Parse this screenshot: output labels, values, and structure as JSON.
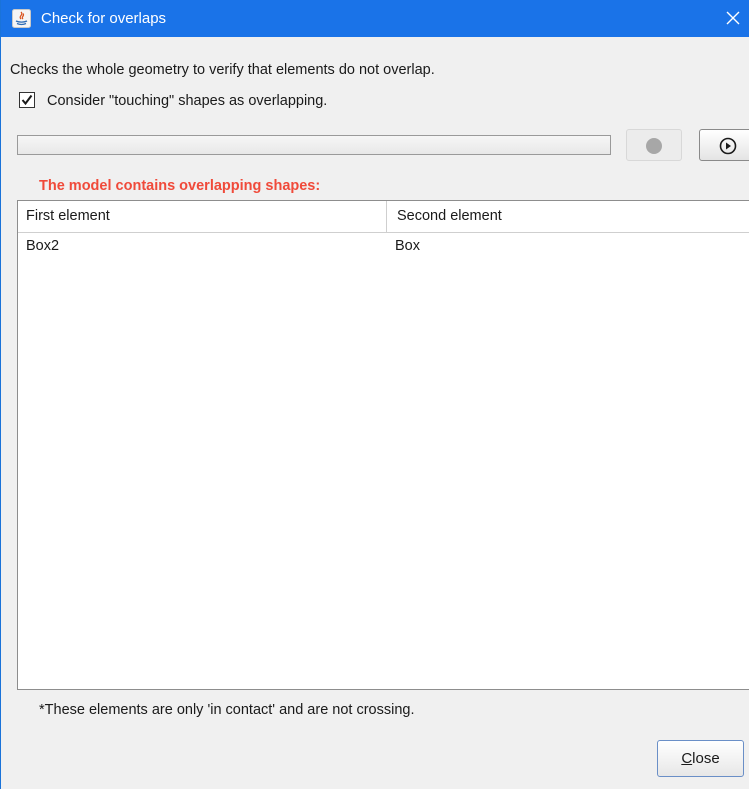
{
  "window": {
    "title": "Check for overlaps",
    "title_icon": "java-app-icon",
    "close_icon": "close-icon",
    "accent_color": "#1a73e8"
  },
  "description": "Checks the whole geometry to verify that elements do not overlap.",
  "option": {
    "label": "Consider \"touching\" shapes as overlapping.",
    "checked": true
  },
  "progress": {
    "fraction": 0
  },
  "controls": {
    "stop_icon": "stop-icon",
    "run_icon": "play-icon"
  },
  "result": {
    "message": "The model contains overlapping shapes:",
    "message_color": "#f04a3a",
    "columns": [
      "First element",
      "Second element"
    ],
    "rows": [
      [
        "Box2",
        "Box"
      ]
    ]
  },
  "footnote": "*These elements are only 'in contact' and are not crossing.",
  "close_button": {
    "mnemonic": "C",
    "rest": "lose"
  }
}
